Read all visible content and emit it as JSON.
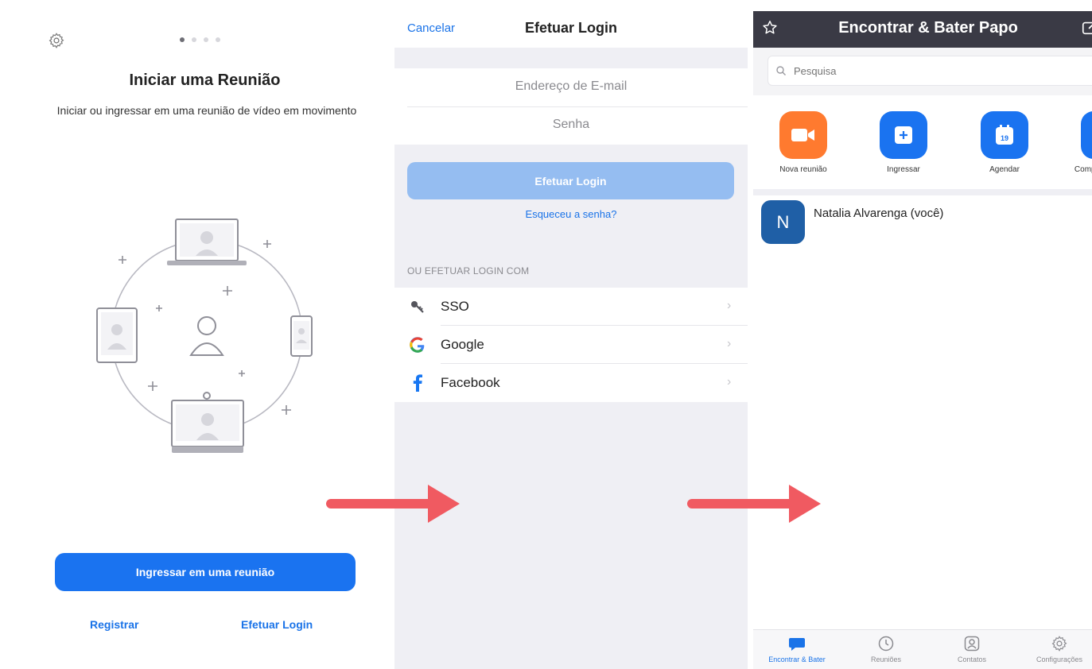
{
  "colors": {
    "brand_blue": "#1a73f0",
    "link_blue": "#1a73e8",
    "disabled_blue": "#95bdf1",
    "orange": "#ff7a2f",
    "arrow_red": "#f05a61",
    "header_dark": "#3a3a45",
    "avatar_blue": "#1f5fa6"
  },
  "start_screen": {
    "settings_icon": "gear-icon",
    "page_indicator": {
      "total": 4,
      "active": 1
    },
    "title": "Iniciar uma Reunião",
    "subtitle": "Iniciar ou ingressar em uma reunião de vídeo em movimento",
    "join_button": "Ingressar em uma reunião",
    "register_link": "Registrar",
    "login_link": "Efetuar Login"
  },
  "login_screen": {
    "cancel": "Cancelar",
    "title": "Efetuar Login",
    "email_placeholder": "Endereço de E-mail",
    "password_placeholder": "Senha",
    "login_button": "Efetuar Login",
    "forgot_password": "Esqueceu a senha?",
    "or_label": "OU EFETUAR LOGIN COM",
    "providers": [
      {
        "label": "SSO",
        "icon": "key-icon"
      },
      {
        "label": "Google",
        "icon": "google-icon"
      },
      {
        "label": "Facebook",
        "icon": "facebook-icon"
      }
    ]
  },
  "home_screen": {
    "title": "Encontrar & Bater Papo",
    "search_placeholder": "Pesquisa",
    "actions": [
      {
        "label": "Nova reunião",
        "icon": "video-camera-icon",
        "color": "#ff7a2f"
      },
      {
        "label": "Ingressar",
        "icon": "plus-square-icon",
        "color": "#1a73f0"
      },
      {
        "label": "Agendar",
        "icon": "calendar-icon",
        "color": "#1a73f0",
        "day": "19"
      },
      {
        "label": "Compartilhar tela",
        "icon": "share-screen-icon",
        "color": "#1a73f0"
      }
    ],
    "contact": {
      "initial": "N",
      "name": "Natalia  Alvarenga (você)"
    },
    "tabs": [
      {
        "label": "Encontrar & Bater",
        "icon": "chat-bubble-icon",
        "active": true
      },
      {
        "label": "Reuniões",
        "icon": "clock-icon",
        "active": false
      },
      {
        "label": "Contatos",
        "icon": "contacts-icon",
        "active": false
      },
      {
        "label": "Configurações",
        "icon": "gear-icon",
        "active": false
      }
    ]
  }
}
